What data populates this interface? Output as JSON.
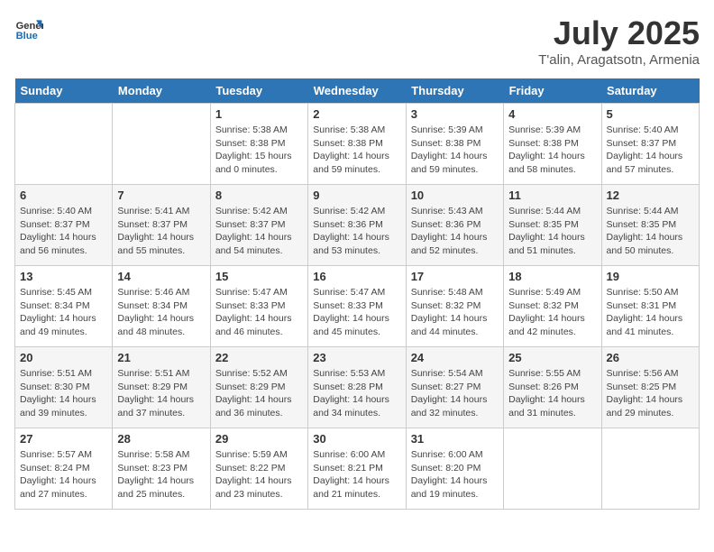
{
  "header": {
    "logo_line1": "General",
    "logo_line2": "Blue",
    "month": "July 2025",
    "location": "T'alin, Aragatsotn, Armenia"
  },
  "weekdays": [
    "Sunday",
    "Monday",
    "Tuesday",
    "Wednesday",
    "Thursday",
    "Friday",
    "Saturday"
  ],
  "weeks": [
    [
      {
        "day": "",
        "empty": true
      },
      {
        "day": "",
        "empty": true
      },
      {
        "day": "1",
        "sunrise": "Sunrise: 5:38 AM",
        "sunset": "Sunset: 8:38 PM",
        "daylight": "Daylight: 15 hours and 0 minutes."
      },
      {
        "day": "2",
        "sunrise": "Sunrise: 5:38 AM",
        "sunset": "Sunset: 8:38 PM",
        "daylight": "Daylight: 14 hours and 59 minutes."
      },
      {
        "day": "3",
        "sunrise": "Sunrise: 5:39 AM",
        "sunset": "Sunset: 8:38 PM",
        "daylight": "Daylight: 14 hours and 59 minutes."
      },
      {
        "day": "4",
        "sunrise": "Sunrise: 5:39 AM",
        "sunset": "Sunset: 8:38 PM",
        "daylight": "Daylight: 14 hours and 58 minutes."
      },
      {
        "day": "5",
        "sunrise": "Sunrise: 5:40 AM",
        "sunset": "Sunset: 8:37 PM",
        "daylight": "Daylight: 14 hours and 57 minutes."
      }
    ],
    [
      {
        "day": "6",
        "sunrise": "Sunrise: 5:40 AM",
        "sunset": "Sunset: 8:37 PM",
        "daylight": "Daylight: 14 hours and 56 minutes."
      },
      {
        "day": "7",
        "sunrise": "Sunrise: 5:41 AM",
        "sunset": "Sunset: 8:37 PM",
        "daylight": "Daylight: 14 hours and 55 minutes."
      },
      {
        "day": "8",
        "sunrise": "Sunrise: 5:42 AM",
        "sunset": "Sunset: 8:37 PM",
        "daylight": "Daylight: 14 hours and 54 minutes."
      },
      {
        "day": "9",
        "sunrise": "Sunrise: 5:42 AM",
        "sunset": "Sunset: 8:36 PM",
        "daylight": "Daylight: 14 hours and 53 minutes."
      },
      {
        "day": "10",
        "sunrise": "Sunrise: 5:43 AM",
        "sunset": "Sunset: 8:36 PM",
        "daylight": "Daylight: 14 hours and 52 minutes."
      },
      {
        "day": "11",
        "sunrise": "Sunrise: 5:44 AM",
        "sunset": "Sunset: 8:35 PM",
        "daylight": "Daylight: 14 hours and 51 minutes."
      },
      {
        "day": "12",
        "sunrise": "Sunrise: 5:44 AM",
        "sunset": "Sunset: 8:35 PM",
        "daylight": "Daylight: 14 hours and 50 minutes."
      }
    ],
    [
      {
        "day": "13",
        "sunrise": "Sunrise: 5:45 AM",
        "sunset": "Sunset: 8:34 PM",
        "daylight": "Daylight: 14 hours and 49 minutes."
      },
      {
        "day": "14",
        "sunrise": "Sunrise: 5:46 AM",
        "sunset": "Sunset: 8:34 PM",
        "daylight": "Daylight: 14 hours and 48 minutes."
      },
      {
        "day": "15",
        "sunrise": "Sunrise: 5:47 AM",
        "sunset": "Sunset: 8:33 PM",
        "daylight": "Daylight: 14 hours and 46 minutes."
      },
      {
        "day": "16",
        "sunrise": "Sunrise: 5:47 AM",
        "sunset": "Sunset: 8:33 PM",
        "daylight": "Daylight: 14 hours and 45 minutes."
      },
      {
        "day": "17",
        "sunrise": "Sunrise: 5:48 AM",
        "sunset": "Sunset: 8:32 PM",
        "daylight": "Daylight: 14 hours and 44 minutes."
      },
      {
        "day": "18",
        "sunrise": "Sunrise: 5:49 AM",
        "sunset": "Sunset: 8:32 PM",
        "daylight": "Daylight: 14 hours and 42 minutes."
      },
      {
        "day": "19",
        "sunrise": "Sunrise: 5:50 AM",
        "sunset": "Sunset: 8:31 PM",
        "daylight": "Daylight: 14 hours and 41 minutes."
      }
    ],
    [
      {
        "day": "20",
        "sunrise": "Sunrise: 5:51 AM",
        "sunset": "Sunset: 8:30 PM",
        "daylight": "Daylight: 14 hours and 39 minutes."
      },
      {
        "day": "21",
        "sunrise": "Sunrise: 5:51 AM",
        "sunset": "Sunset: 8:29 PM",
        "daylight": "Daylight: 14 hours and 37 minutes."
      },
      {
        "day": "22",
        "sunrise": "Sunrise: 5:52 AM",
        "sunset": "Sunset: 8:29 PM",
        "daylight": "Daylight: 14 hours and 36 minutes."
      },
      {
        "day": "23",
        "sunrise": "Sunrise: 5:53 AM",
        "sunset": "Sunset: 8:28 PM",
        "daylight": "Daylight: 14 hours and 34 minutes."
      },
      {
        "day": "24",
        "sunrise": "Sunrise: 5:54 AM",
        "sunset": "Sunset: 8:27 PM",
        "daylight": "Daylight: 14 hours and 32 minutes."
      },
      {
        "day": "25",
        "sunrise": "Sunrise: 5:55 AM",
        "sunset": "Sunset: 8:26 PM",
        "daylight": "Daylight: 14 hours and 31 minutes."
      },
      {
        "day": "26",
        "sunrise": "Sunrise: 5:56 AM",
        "sunset": "Sunset: 8:25 PM",
        "daylight": "Daylight: 14 hours and 29 minutes."
      }
    ],
    [
      {
        "day": "27",
        "sunrise": "Sunrise: 5:57 AM",
        "sunset": "Sunset: 8:24 PM",
        "daylight": "Daylight: 14 hours and 27 minutes."
      },
      {
        "day": "28",
        "sunrise": "Sunrise: 5:58 AM",
        "sunset": "Sunset: 8:23 PM",
        "daylight": "Daylight: 14 hours and 25 minutes."
      },
      {
        "day": "29",
        "sunrise": "Sunrise: 5:59 AM",
        "sunset": "Sunset: 8:22 PM",
        "daylight": "Daylight: 14 hours and 23 minutes."
      },
      {
        "day": "30",
        "sunrise": "Sunrise: 6:00 AM",
        "sunset": "Sunset: 8:21 PM",
        "daylight": "Daylight: 14 hours and 21 minutes."
      },
      {
        "day": "31",
        "sunrise": "Sunrise: 6:00 AM",
        "sunset": "Sunset: 8:20 PM",
        "daylight": "Daylight: 14 hours and 19 minutes."
      },
      {
        "day": "",
        "empty": true
      },
      {
        "day": "",
        "empty": true
      }
    ]
  ]
}
